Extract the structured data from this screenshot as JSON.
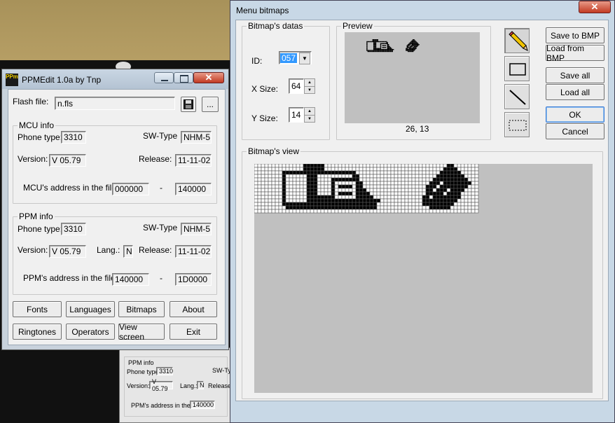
{
  "ppm_window": {
    "title": "PPMEdit 1.0a by Tnp",
    "logo_text": "PPm",
    "flash_label": "Flash file:",
    "flash_value": "n.fls",
    "browse_label": "...",
    "mcu": {
      "title": "MCU info",
      "phone_type_label": "Phone type:",
      "phone_type": "3310",
      "sw_type_label": "SW-Type",
      "sw_type": "NHM-5",
      "version_label": "Version:",
      "version": "V 05.79",
      "release_label": "Release:",
      "release": "11-11-02",
      "address_label": "MCU's address in the file:",
      "address_from": "000000",
      "address_to": "140000",
      "dash": "-"
    },
    "ppm": {
      "title": "PPM info",
      "phone_type_label": "Phone type:",
      "phone_type": "3310",
      "sw_type_label": "SW-Type",
      "sw_type": "NHM-5",
      "version_label": "Version:",
      "version": "V 05.79",
      "lang_label": "Lang.:",
      "lang": "N",
      "release_label": "Release:",
      "release": "11-11-02",
      "address_label": "PPM's address in the file:",
      "address_from": "140000",
      "address_to": "1D0000",
      "dash": "-"
    },
    "buttons": {
      "fonts": "Fonts",
      "languages": "Languages",
      "bitmaps": "Bitmaps",
      "about": "About",
      "ringtones": "Ringtones",
      "operators": "Operators",
      "view_screen": "View screen",
      "exit": "Exit"
    }
  },
  "bg_window": {
    "ppm_title": "PPM info",
    "phone_type_label": "Phone type:",
    "phone_type": "3310",
    "sw_type_label": "SW-Typ",
    "version_label": "Version:",
    "version": "V 05.79",
    "lang_label": "Lang.:",
    "lang": "N",
    "release_label": "Release:",
    "address_label": "PPM's address in the file:",
    "address_from": "140000"
  },
  "bitmaps_window": {
    "title": "Menu bitmaps",
    "datas_title": "Bitmap's datas",
    "id_label": "ID:",
    "id_value": "057",
    "xsize_label": "X Size:",
    "xsize_value": "64",
    "ysize_label": "Y Size:",
    "ysize_value": "14",
    "preview_title": "Preview",
    "coords": "26, 13",
    "view_title": "Bitmap's view",
    "buttons": {
      "save_to_bmp": "Save to BMP",
      "load_from_bmp": "Load from BMP",
      "save_all": "Save all",
      "load_all": "Load all",
      "ok": "OK",
      "cancel": "Cancel"
    },
    "tools": [
      "pencil-icon",
      "rectangle-icon",
      "line-icon",
      "selection-icon"
    ]
  },
  "bitmap": {
    "width": 64,
    "height": 14,
    "rows": [
      "0000000000000011111100000000000000000000000000000000000110000000",
      "0000000000000011111100000000000000000000000000000000001111000000",
      "0000000011111111111111111111100000000000000000000000011111100000",
      "0000000010000001110000000000110000000000000000000000111111110000",
      "0000000010000001110000111111110000000000000000000001111111111000",
      "0000000010000001110000100000011000000000000000000011101111111100",
      "0000000010000001110000101111011000000000000000000111011111111000",
      "0000000010000001110000100000011100000000000000000110111011110000",
      "0000000010000001110000101111011110000000000000000111110111100000",
      "0000000010000001111111100000011111000000000000001101111111100000",
      "0000000010000001111111111111111111110000000000001111111111000000",
      "0000000011111111111111111111111111100000000000001111111110000000",
      "0000000001111111111111111111111111100000000000000011111100000000",
      "0000000000000000000000000000000000000000000000000000000000000000"
    ]
  },
  "colors": {
    "pixel_on": "#000000",
    "pixel_off": "#ffffff",
    "grid": "#555555",
    "canvas_bg": "#c0c0c0",
    "id_selected": "#3399ff"
  }
}
